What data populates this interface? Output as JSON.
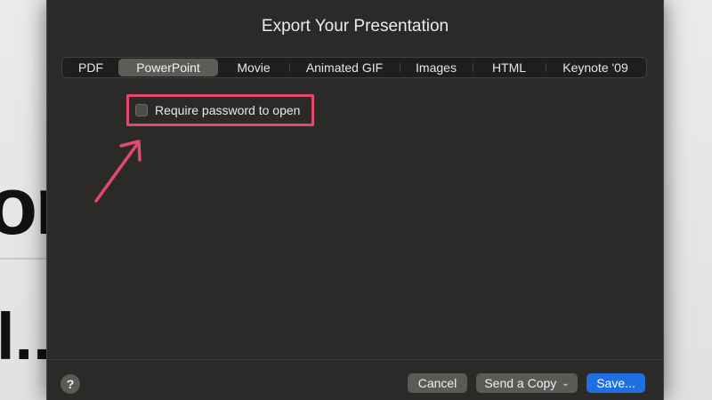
{
  "background": {
    "heading_fragment": "on",
    "text_fragment": "l..."
  },
  "dialog": {
    "title": "Export Your Presentation",
    "tabs": [
      {
        "label": "PDF",
        "active": false
      },
      {
        "label": "PowerPoint",
        "active": true
      },
      {
        "label": "Movie",
        "active": false
      },
      {
        "label": "Animated GIF",
        "active": false
      },
      {
        "label": "Images",
        "active": false
      },
      {
        "label": "HTML",
        "active": false
      },
      {
        "label": "Keynote '09",
        "active": false
      }
    ],
    "option": {
      "label": "Require password to open",
      "checked": false
    },
    "footer": {
      "help_label": "?",
      "cancel_label": "Cancel",
      "send_copy_label": "Send a Copy",
      "save_label": "Save..."
    }
  },
  "colors": {
    "annotation": "#e2496b",
    "primary_button": "#1f6fe0",
    "dialog_bg": "#2c2a28"
  },
  "icons": {
    "help": "question-mark-icon",
    "dropdown": "chevron-down-icon",
    "annotation": "arrow-icon"
  }
}
